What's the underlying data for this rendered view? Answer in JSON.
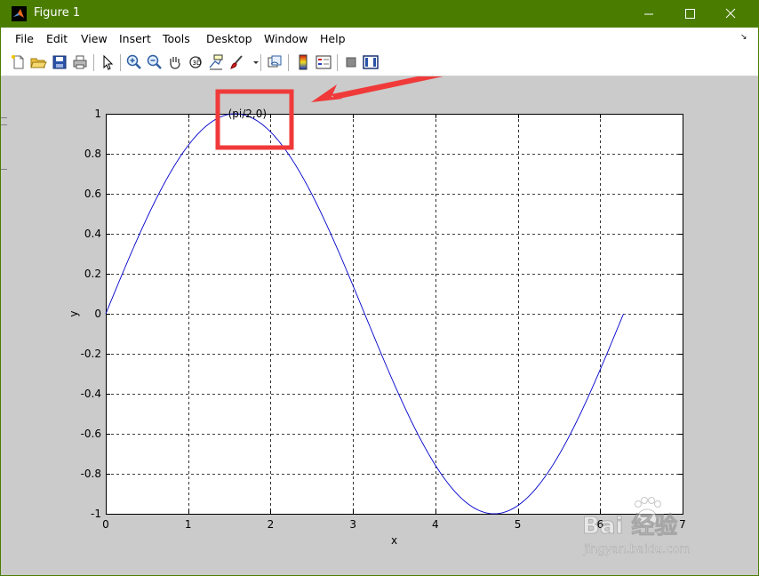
{
  "window": {
    "title": "Figure 1"
  },
  "menu": {
    "items": [
      "File",
      "Edit",
      "View",
      "Insert",
      "Tools",
      "Desktop",
      "Window",
      "Help"
    ]
  },
  "toolbar": {
    "icons": [
      "new-figure-icon",
      "open-file-icon",
      "save-icon",
      "print-icon",
      "edit-plot-arrow-icon",
      "zoom-in-icon",
      "zoom-out-icon",
      "pan-hand-icon",
      "rotate-3d-icon",
      "data-cursor-icon",
      "brush-icon",
      "link-plot-icon",
      "colorbar-icon",
      "legend-icon",
      "hide-plot-tools-icon",
      "show-plot-tools-icon"
    ]
  },
  "chart_data": {
    "type": "line",
    "title": "",
    "xlabel": "x",
    "ylabel": "y",
    "xlim": [
      0,
      7
    ],
    "ylim": [
      -1,
      1
    ],
    "xticks": [
      "0",
      "1",
      "2",
      "3",
      "4",
      "5",
      "6",
      "7"
    ],
    "yticks": [
      "1",
      "0.8",
      "0.6",
      "0.4",
      "0.2",
      "0",
      "-0.2",
      "-0.4",
      "-0.6",
      "-0.8",
      "-1"
    ],
    "grid": true,
    "grid_style": "dotted-black",
    "series": [
      {
        "function": "y = sin(x)",
        "x_range": [
          0,
          6.2832
        ],
        "x": [
          0,
          0.5,
          1,
          1.5708,
          2,
          2.5,
          3,
          3.1416,
          3.5,
          4,
          4.5,
          4.7124,
          5,
          5.5,
          6,
          6.2832
        ],
        "y": [
          0,
          0.479,
          0.841,
          1,
          0.909,
          0.598,
          0.141,
          0,
          -0.351,
          -0.757,
          -0.978,
          -1,
          -0.959,
          -0.706,
          -0.279,
          0
        ],
        "color": "#0000cc"
      }
    ],
    "annotations": [
      {
        "text": "(pi/2,0)",
        "x": 1.5708,
        "y": 1
      }
    ],
    "highlight_color": "#f03a3a"
  },
  "watermark": {
    "text": "Bai 经验",
    "url_text": "jingyan.baidu.com"
  }
}
